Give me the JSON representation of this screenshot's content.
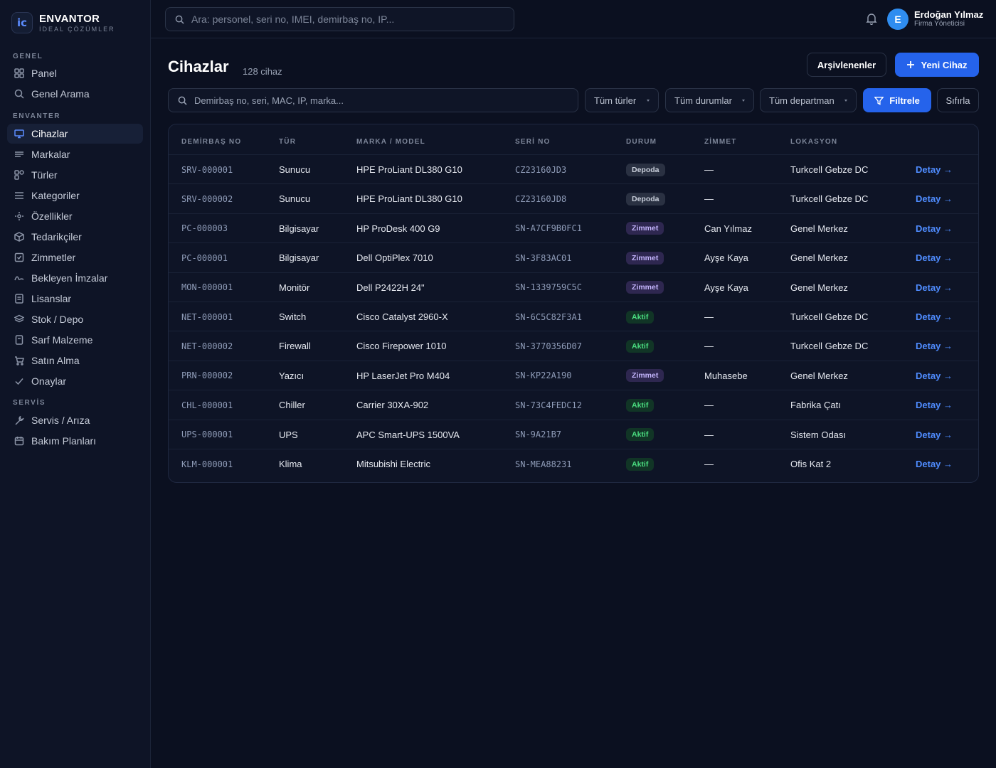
{
  "brand": {
    "logo_text": "ic",
    "title": "ENVANTOR",
    "subtitle": "İDEAL ÇÖZÜMLER"
  },
  "sidebar": {
    "sections": [
      {
        "label": "GENEL"
      },
      {
        "label": "ENVANTER"
      },
      {
        "label": "SERVİS"
      }
    ],
    "items": [
      {
        "label": "Panel",
        "icon": "grid-icon"
      },
      {
        "label": "Genel Arama",
        "icon": "search-icon"
      },
      {
        "label": "Cihazlar",
        "icon": "monitor-icon",
        "active": true
      },
      {
        "label": "Markalar",
        "icon": "lines-icon"
      },
      {
        "label": "Türler",
        "icon": "shapes-icon"
      },
      {
        "label": "Kategoriler",
        "icon": "list-icon"
      },
      {
        "label": "Özellikler",
        "icon": "sparkle-icon"
      },
      {
        "label": "Tedarikçiler",
        "icon": "box-icon"
      },
      {
        "label": "Zimmetler",
        "icon": "check-square-icon"
      },
      {
        "label": "Bekleyen İmzalar",
        "icon": "signature-icon"
      },
      {
        "label": "Lisanslar",
        "icon": "document-icon"
      },
      {
        "label": "Stok / Depo",
        "icon": "layers-icon"
      },
      {
        "label": "Sarf Malzeme",
        "icon": "file-icon"
      },
      {
        "label": "Satın Alma",
        "icon": "cart-icon"
      },
      {
        "label": "Onaylar",
        "icon": "check-icon"
      },
      {
        "label": "Servis / Arıza",
        "icon": "wrench-icon"
      },
      {
        "label": "Bakım Planları",
        "icon": "calendar-icon"
      }
    ]
  },
  "topbar": {
    "search_placeholder": "Ara: personel, seri no, IMEI, demirbaş no, IP...",
    "user": {
      "initial": "E",
      "name": "Erdoğan Yılmaz",
      "role": "Firma Yöneticisi"
    }
  },
  "page": {
    "title": "Cihazlar",
    "count": "128 cihaz",
    "archived_label": "Arşivlenenler",
    "new_label": "Yeni Cihaz"
  },
  "filters": {
    "search_placeholder": "Demirbaş no, seri, MAC, IP, marka...",
    "type_select": "Tüm türler",
    "status_select": "Tüm durumlar",
    "department_select": "Tüm departman",
    "filter_label": "Filtrele",
    "reset_label": "Sıfırla"
  },
  "table": {
    "columns": [
      "DEMİRBAŞ NO",
      "TÜR",
      "MARKA / MODEL",
      "SERİ NO",
      "DURUM",
      "ZİMMET",
      "LOKASYON"
    ],
    "detail_label": "Detay →",
    "status_colors": {
      "Depoda": {
        "bg": "#2a3142",
        "fg": "#c9cfdb"
      },
      "Zimmet": {
        "bg": "#2e2750",
        "fg": "#c4b5fd"
      },
      "Aktif": {
        "bg": "#113526",
        "fg": "#4ade80"
      }
    },
    "rows": [
      {
        "asset": "SRV-000001",
        "type": "Sunucu",
        "model": "HPE ProLiant DL380 G10",
        "serial": "CZ23160JD3",
        "status": "Depoda",
        "assignee": "—",
        "location": "Turkcell Gebze DC"
      },
      {
        "asset": "SRV-000002",
        "type": "Sunucu",
        "model": "HPE ProLiant DL380 G10",
        "serial": "CZ23160JD8",
        "status": "Depoda",
        "assignee": "—",
        "location": "Turkcell Gebze DC"
      },
      {
        "asset": "PC-000003",
        "type": "Bilgisayar",
        "model": "HP ProDesk 400 G9",
        "serial": "SN-A7CF9B0FC1",
        "status": "Zimmet",
        "assignee": "Can Yılmaz",
        "location": "Genel Merkez"
      },
      {
        "asset": "PC-000001",
        "type": "Bilgisayar",
        "model": "Dell OptiPlex 7010",
        "serial": "SN-3F83AC01",
        "status": "Zimmet",
        "assignee": "Ayşe Kaya",
        "location": "Genel Merkez"
      },
      {
        "asset": "MON-000001",
        "type": "Monitör",
        "model": "Dell P2422H 24\"",
        "serial": "SN-1339759C5C",
        "status": "Zimmet",
        "assignee": "Ayşe Kaya",
        "location": "Genel Merkez"
      },
      {
        "asset": "NET-000001",
        "type": "Switch",
        "model": "Cisco Catalyst 2960-X",
        "serial": "SN-6C5C82F3A1",
        "status": "Aktif",
        "assignee": "—",
        "location": "Turkcell Gebze DC"
      },
      {
        "asset": "NET-000002",
        "type": "Firewall",
        "model": "Cisco Firepower 1010",
        "serial": "SN-3770356D07",
        "status": "Aktif",
        "assignee": "—",
        "location": "Turkcell Gebze DC"
      },
      {
        "asset": "PRN-000002",
        "type": "Yazıcı",
        "model": "HP LaserJet Pro M404",
        "serial": "SN-KP22A190",
        "status": "Zimmet",
        "assignee": "Muhasebe",
        "location": "Genel Merkez"
      },
      {
        "asset": "CHL-000001",
        "type": "Chiller",
        "model": "Carrier 30XA-902",
        "serial": "SN-73C4FEDC12",
        "status": "Aktif",
        "assignee": "—",
        "location": "Fabrika Çatı"
      },
      {
        "asset": "UPS-000001",
        "type": "UPS",
        "model": "APC Smart-UPS 1500VA",
        "serial": "SN-9A21B7",
        "status": "Aktif",
        "assignee": "—",
        "location": "Sistem Odası"
      },
      {
        "asset": "KLM-000001",
        "type": "Klima",
        "model": "Mitsubishi Electric",
        "serial": "SN-MEA88231",
        "status": "Aktif",
        "assignee": "—",
        "location": "Ofis Kat 2"
      }
    ]
  }
}
